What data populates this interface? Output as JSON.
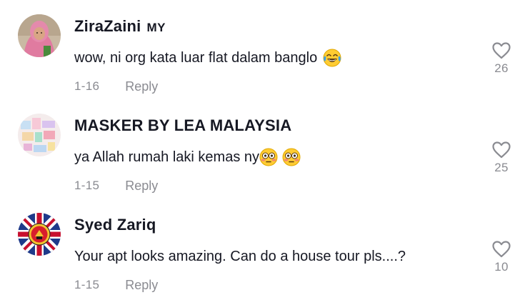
{
  "comments": [
    {
      "username": "ZiraZaini",
      "country": "MY",
      "text": "wow, ni org kata luar flat dalam banglo",
      "emojis": [
        "face-with-tears-of-joy"
      ],
      "date": "1-16",
      "reply_label": "Reply",
      "likes": "26",
      "avatar": "user-photo-pink-hijab"
    },
    {
      "username": "MASKER BY LEA MALAYSIA",
      "country": "",
      "text": "ya Allah rumah laki kemas ny",
      "emojis": [
        "flushed-face",
        "flushed-face"
      ],
      "date": "1-15",
      "reply_label": "Reply",
      "likes": "25",
      "avatar": "product-collage"
    },
    {
      "username": "Syed Zariq",
      "country": "",
      "text": "Your apt looks amazing. Can do a house tour pls....?",
      "emojis": [],
      "date": "1-15",
      "reply_label": "Reply",
      "likes": "10",
      "avatar": "union-jack-crest"
    }
  ],
  "colors": {
    "text": "#161823",
    "muted": "#8a8b91",
    "background": "#ffffff"
  }
}
